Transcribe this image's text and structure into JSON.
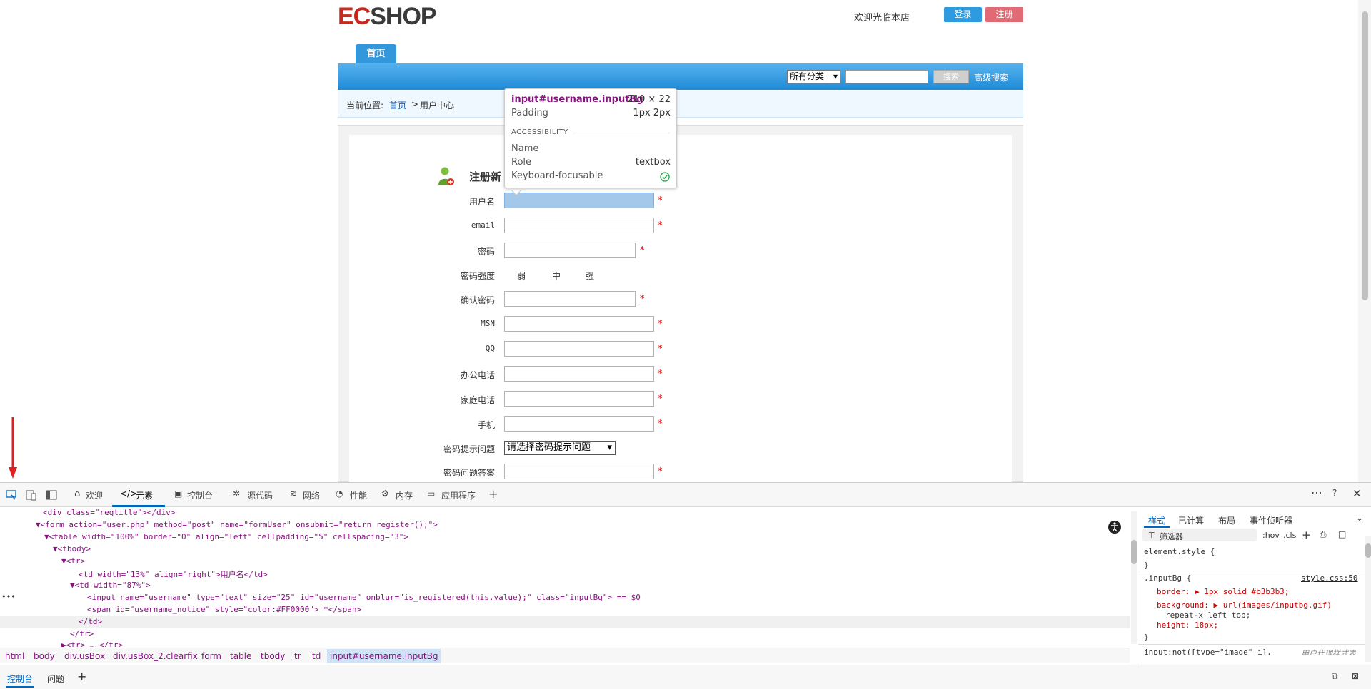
{
  "header": {
    "logo_ec": "EC",
    "logo_shop": "SHOP",
    "welcome": "欢迎光临本店",
    "login": "登录",
    "register": "注册"
  },
  "nav": {
    "home_tab": "首页",
    "category_select": "所有分类",
    "search_button": "搜索",
    "advanced_search": "高级搜索"
  },
  "breadcrumb": {
    "label": "当前位置:",
    "home": "首页",
    "sep": ">",
    "current": "用户中心"
  },
  "form": {
    "title": "注册新",
    "fields": [
      {
        "label": "用户名",
        "required": "*"
      },
      {
        "label": "email",
        "required": "*"
      },
      {
        "label": "密码",
        "required": "*"
      },
      {
        "label": "密码强度"
      },
      {
        "label": "确认密码",
        "required": "*"
      },
      {
        "label": "MSN",
        "required": "*"
      },
      {
        "label": "QQ",
        "required": "*"
      },
      {
        "label": "办公电话",
        "required": "*"
      },
      {
        "label": "家庭电话",
        "required": "*"
      },
      {
        "label": "手机",
        "required": "*"
      },
      {
        "label": "密码提示问题"
      },
      {
        "label": "密码问题答案",
        "required": "*"
      }
    ],
    "strength": [
      "弱",
      "中",
      "强"
    ],
    "question_select": "请选择密码提示问题"
  },
  "tooltip": {
    "element": "input#username.inputBg",
    "size": "210 × 22",
    "padding_label": "Padding",
    "padding_value": "1px 2px",
    "section": "ACCESSIBILITY",
    "name_label": "Name",
    "role_label": "Role",
    "role_value": "textbox",
    "focus_label": "Keyboard-focusable"
  },
  "devtools": {
    "tabs": [
      "欢迎",
      "元素",
      "控制台",
      "源代码",
      "网络",
      "性能",
      "内存",
      "应用程序"
    ],
    "dom_lines": [
      "<div class=\"regtitle\"></div>",
      "▼<form action=\"user.php\" method=\"post\" name=\"formUser\" onsubmit=\"return register();\">",
      "▼<table width=\"100%\" border=\"0\" align=\"left\" cellpadding=\"5\" cellspacing=\"3\">",
      "▼<tbody>",
      "▼<tr>",
      "<td width=\"13%\" align=\"right\">用户名</td>",
      "▼<td width=\"87%\">",
      "<input name=\"username\" type=\"text\" size=\"25\" id=\"username\" onblur=\"is_registered(this.value);\" class=\"inputBg\"> == $0",
      "<span id=\"username_notice\" style=\"color:#FF0000\"> *</span>",
      "</td>",
      "</tr>",
      "▶<tr> … </tr>"
    ],
    "breadcrumbs": [
      "html",
      "body",
      "div.usBox",
      "div.usBox_2.clearfix",
      "form",
      "table",
      "tbody",
      "tr",
      "td",
      "input#username.inputBg"
    ],
    "style_tabs": [
      "样式",
      "已计算",
      "布局",
      "事件侦听器"
    ],
    "filter": "筛选器",
    "hov": ":hov",
    ".cls": ".cls",
    "rules": [
      "element.style {",
      "}",
      ".inputBg {",
      "border: ▶ 1px solid #b3b3b3;",
      "background: ▶ url(images/inputbg.gif)",
      "repeat-x left top;",
      "height: 18px;",
      "}",
      "input:not([type=\"image\" i],"
    ],
    "rule_source": "style.css:50",
    "ua_note": "用户代理样式表",
    "drawer_tabs": [
      "控制台",
      "问题"
    ]
  }
}
